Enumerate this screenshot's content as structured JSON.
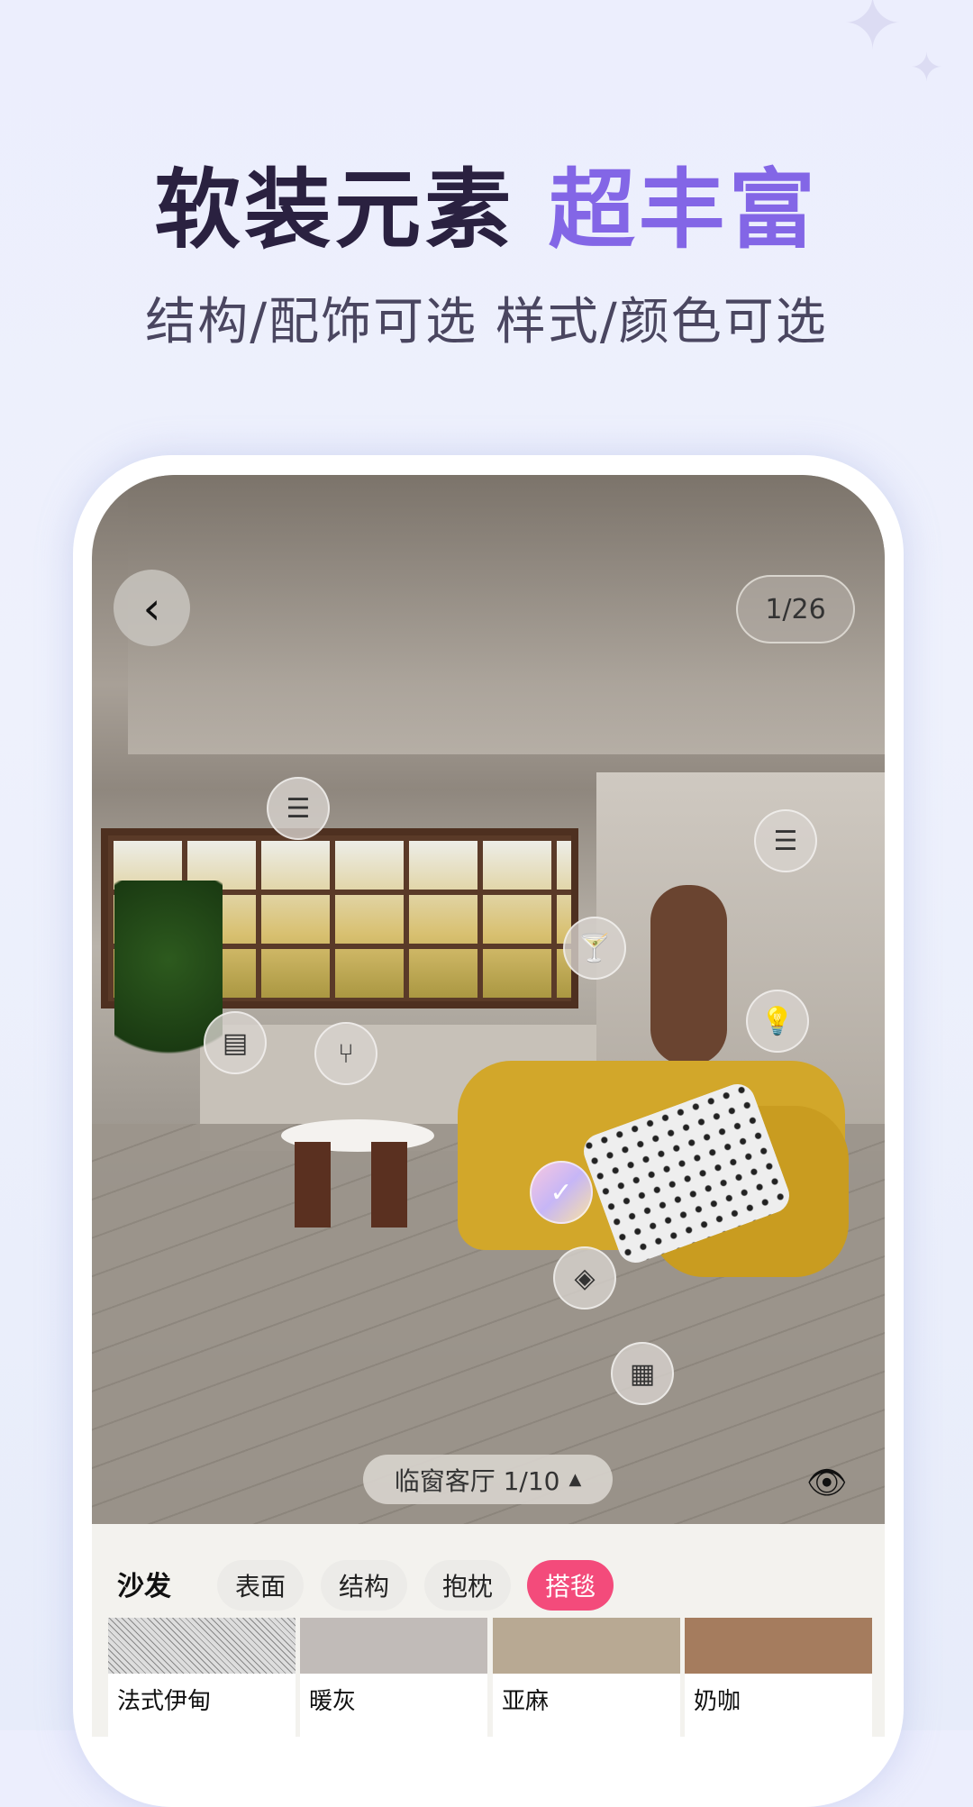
{
  "headline": {
    "part1": "软装元素",
    "part2": "超丰富",
    "subtitle": "结构/配饰可选 样式/颜色可选"
  },
  "colors": {
    "accent": "#8366e6",
    "active_tab": "#f34b7b"
  },
  "viewer": {
    "counter": "1/26",
    "room_label": "临窗客厅 1/10",
    "back_icon": "chevron-left-icon",
    "room_caret": "▲",
    "eye_icon": "eye-icon"
  },
  "hotspots": [
    {
      "icon": "wall-panel-icon",
      "glyph": "☰"
    },
    {
      "icon": "wall-panel-icon",
      "glyph": "☰"
    },
    {
      "icon": "wine-glass-icon",
      "glyph": "🍸"
    },
    {
      "icon": "lamp-icon",
      "glyph": "💡"
    },
    {
      "icon": "cabinet-icon",
      "glyph": "▤"
    },
    {
      "icon": "chair-icon",
      "glyph": "⑂"
    },
    {
      "icon": "check-icon",
      "glyph": "✓"
    },
    {
      "icon": "rug-icon",
      "glyph": "◈"
    },
    {
      "icon": "panel-icon",
      "glyph": "▦"
    }
  ],
  "panel": {
    "category": "沙发",
    "tabs": [
      {
        "label": "表面"
      },
      {
        "label": "结构"
      },
      {
        "label": "抱枕"
      },
      {
        "label": "搭毯",
        "active": true
      }
    ],
    "swatches": [
      {
        "label": "法式伊甸",
        "color": "#e0ddd8"
      },
      {
        "label": "暖灰",
        "color": "#c1bbb8"
      },
      {
        "label": "亚麻",
        "color": "#b8a993"
      },
      {
        "label": "奶咖",
        "color": "#a57c5e"
      }
    ]
  }
}
